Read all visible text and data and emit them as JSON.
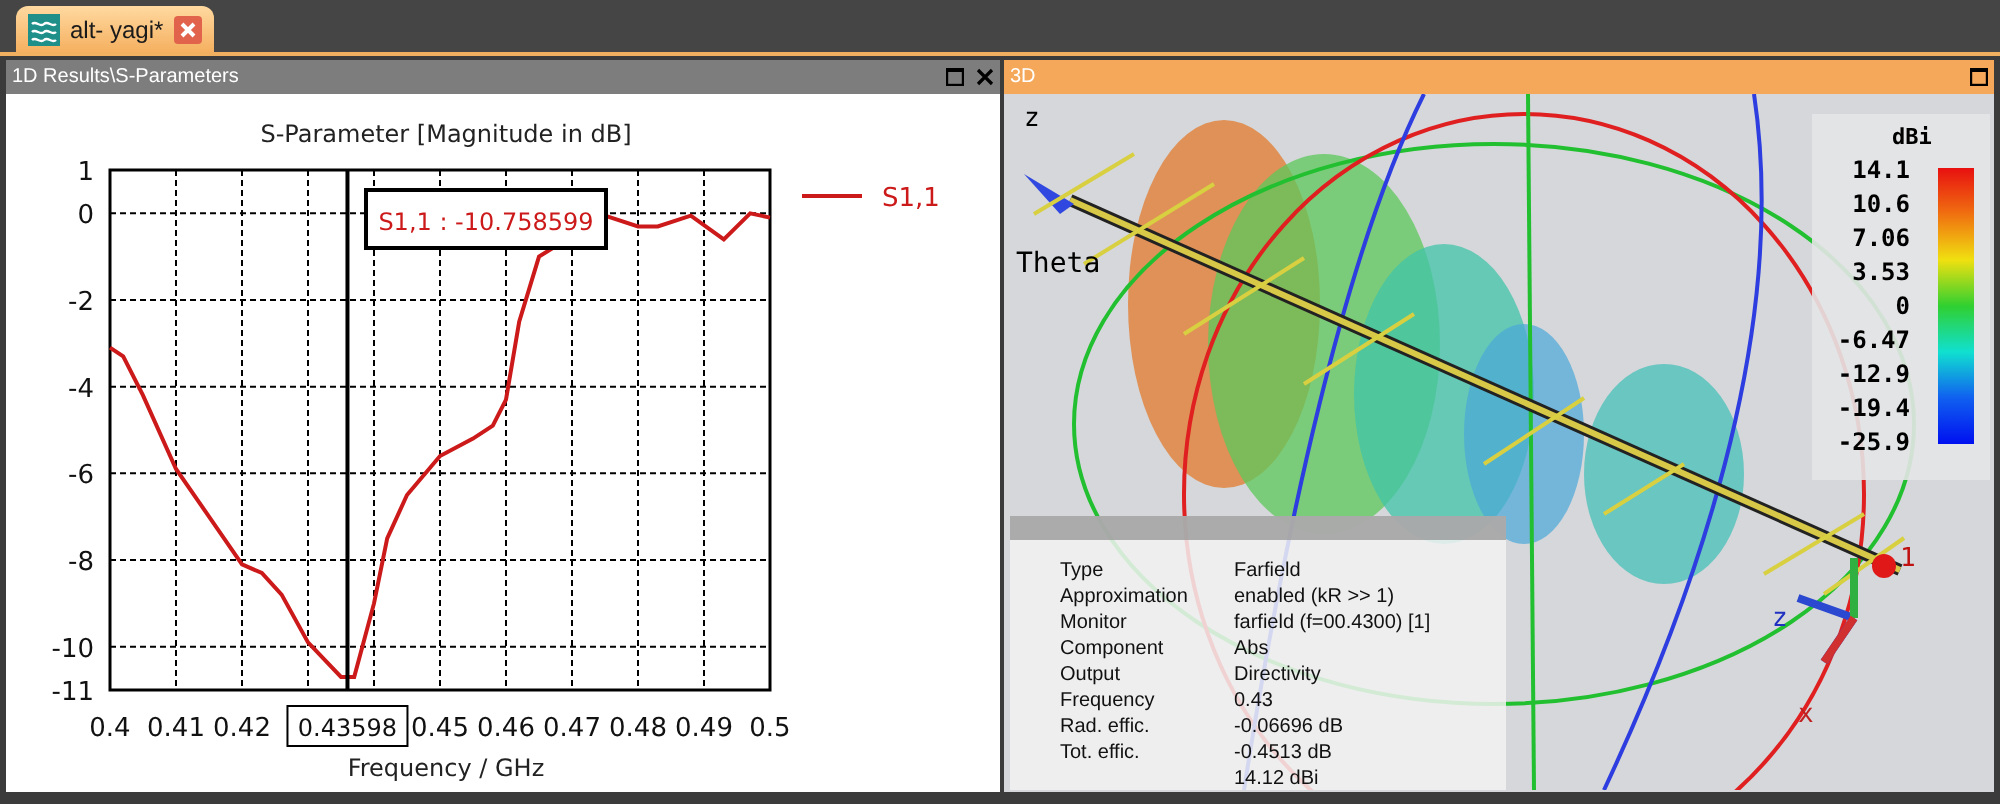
{
  "tab": {
    "title": "alt- yagi*",
    "selected": true
  },
  "left_panel": {
    "title": "1D Results\\S-Parameters",
    "chart_data": {
      "type": "line",
      "title": "S-Parameter [Magnitude in dB]",
      "xlabel": "Frequency / GHz",
      "x": [
        0.4,
        0.402,
        0.405,
        0.41,
        0.415,
        0.42,
        0.423,
        0.426,
        0.43,
        0.435,
        0.437,
        0.44,
        0.442,
        0.445,
        0.45,
        0.455,
        0.458,
        0.46,
        0.462,
        0.465,
        0.475,
        0.48,
        0.483,
        0.488,
        0.493,
        0.497,
        0.5
      ],
      "series": [
        {
          "name": "S1,1",
          "color": "#cc1a1a",
          "values": [
            -3.1,
            -3.3,
            -4.2,
            -5.9,
            -7.0,
            -8.1,
            -8.3,
            -8.8,
            -9.9,
            -10.7,
            -10.7,
            -9.0,
            -7.5,
            -6.5,
            -5.6,
            -5.2,
            -4.9,
            -4.3,
            -2.5,
            -1.0,
            -0.05,
            -0.3,
            -0.3,
            -0.05,
            -0.6,
            0,
            -0.1
          ]
        }
      ],
      "xlim": [
        0.4,
        0.5
      ],
      "ylim": [
        -11,
        1
      ],
      "xticks": [
        0.4,
        0.41,
        0.42,
        0.45,
        0.46,
        0.47,
        0.48,
        0.49,
        0.5
      ],
      "yticks": [
        1,
        0,
        -2,
        -4,
        -6,
        -8,
        -10,
        -11
      ],
      "grid": true,
      "ref_lines": [
        {
          "axis": "x",
          "value": 0.43598,
          "label": "0.43598"
        }
      ],
      "annotations": [
        "S1,1 : -10.758599"
      ]
    }
  },
  "right_panel": {
    "title": "3D",
    "legend": {
      "unit": "dBi",
      "ticks": [
        "14.1",
        "10.6",
        "7.06",
        "3.53",
        "0",
        "-6.47",
        "-12.9",
        "-19.4",
        "-25.9"
      ]
    },
    "view_labels": [
      {
        "text": "z"
      },
      {
        "text": "Theta"
      },
      {
        "text": "1"
      },
      {
        "text": "z"
      },
      {
        "text": "x"
      }
    ],
    "info": [
      {
        "label": "Type",
        "value": "Farfield"
      },
      {
        "label": "Approximation",
        "value": "enabled (kR >> 1)"
      },
      {
        "label": "Monitor",
        "value": "farfield (f=00.4300) [1]"
      },
      {
        "label": "Component",
        "value": "Abs"
      },
      {
        "label": "Output",
        "value": "Directivity"
      },
      {
        "label": "Frequency",
        "value": "0.43"
      },
      {
        "label": "Rad. effic.",
        "value": "-0.06696 dB"
      },
      {
        "label": "Tot. effic.",
        "value": "-0.4513 dB"
      },
      {
        "value": "14.12 dBi"
      }
    ]
  }
}
